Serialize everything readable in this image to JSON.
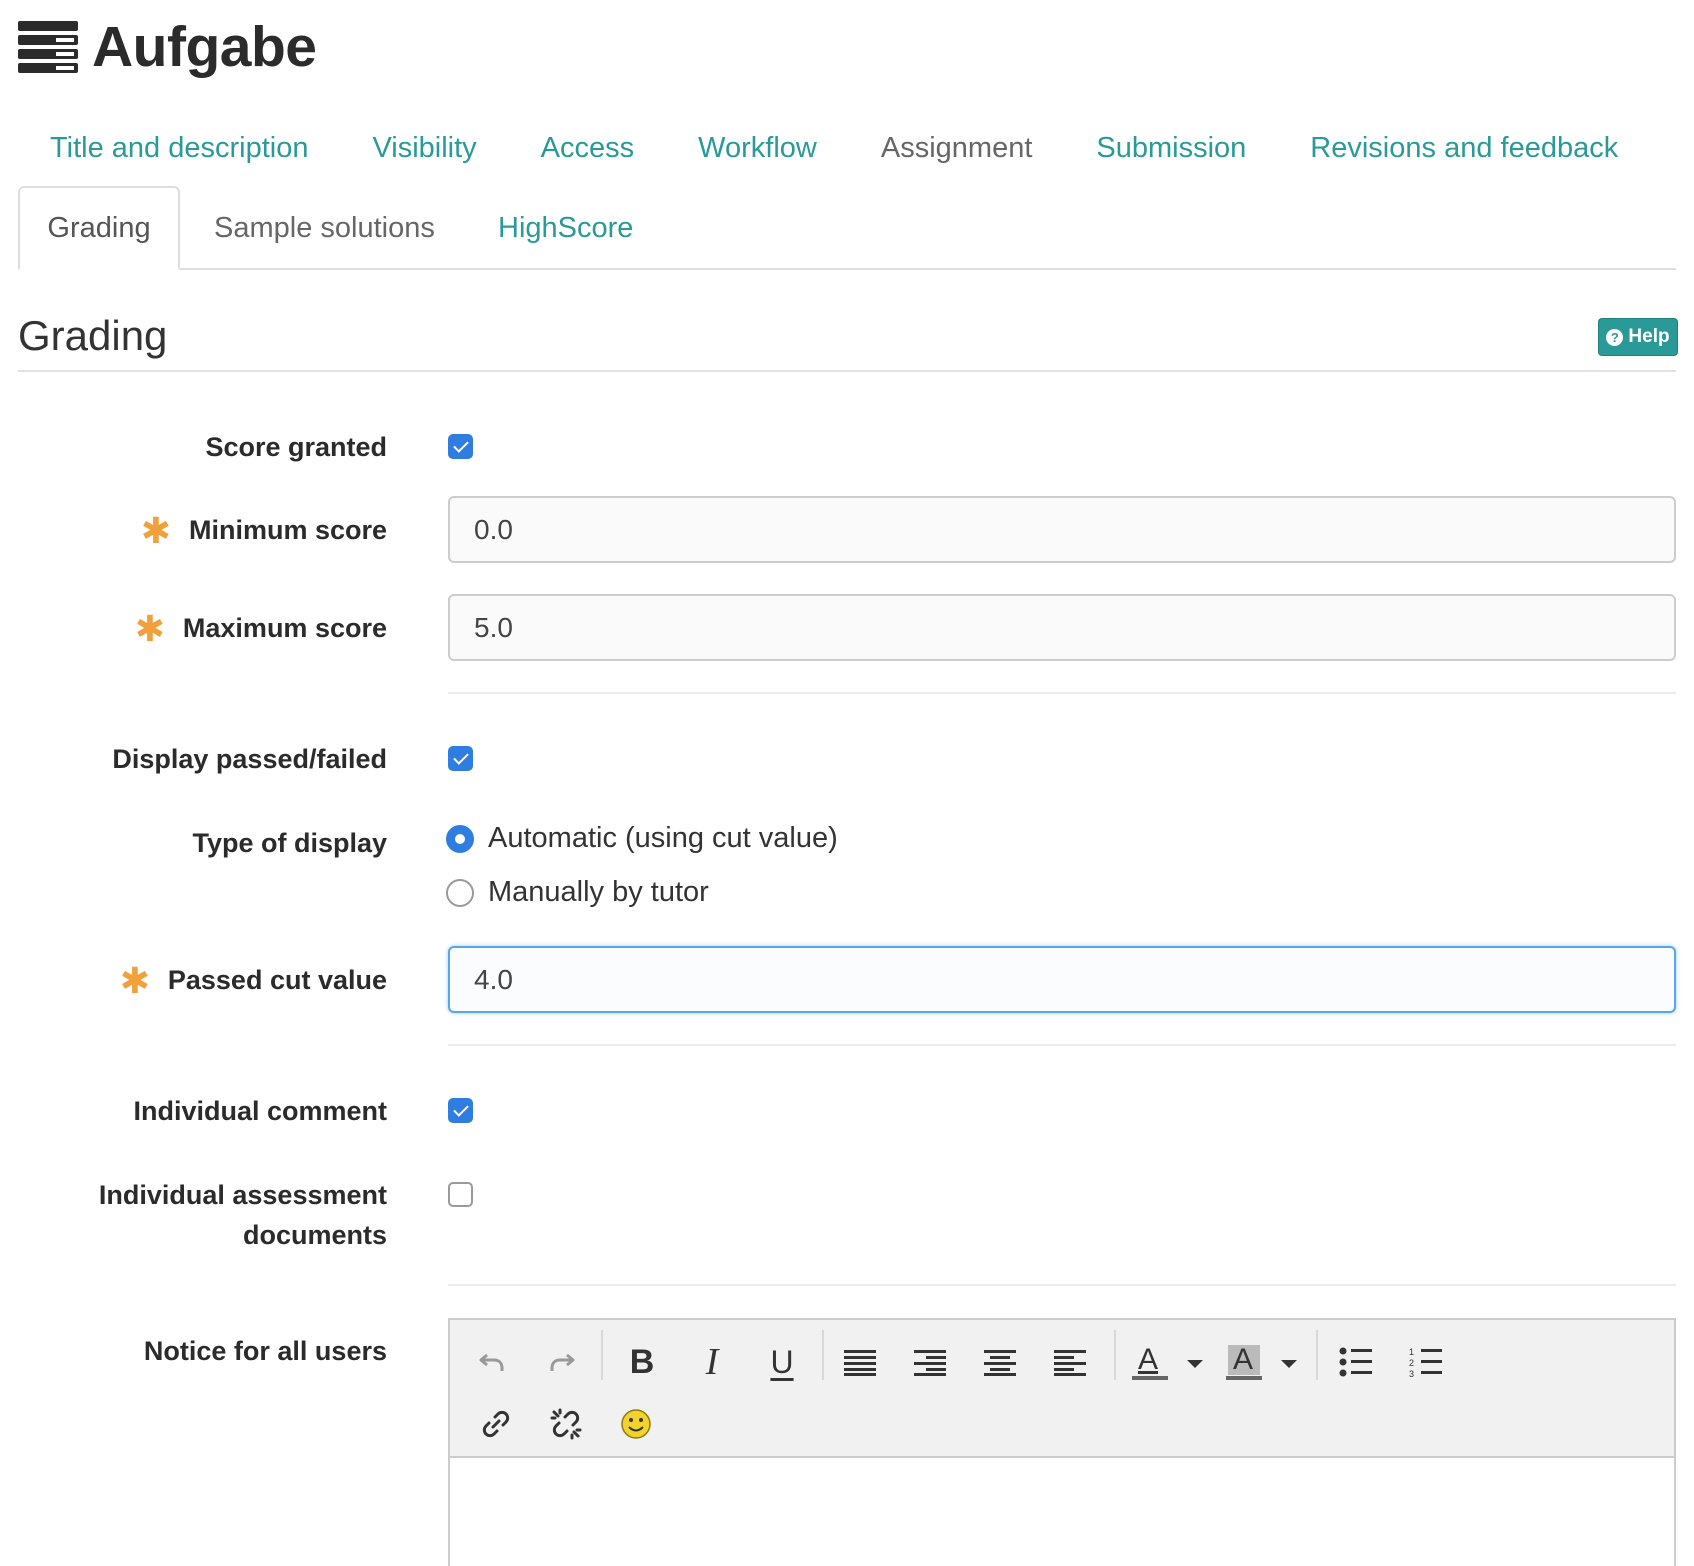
{
  "header": {
    "title": "Aufgabe",
    "icon": "course-node-list-icon"
  },
  "tabs_row1": [
    {
      "label": "Title and description",
      "active": false
    },
    {
      "label": "Visibility",
      "active": false
    },
    {
      "label": "Access",
      "active": false
    },
    {
      "label": "Workflow",
      "active": false
    },
    {
      "label": "Assignment",
      "active": false
    },
    {
      "label": "Submission",
      "active": false
    },
    {
      "label": "Revisions and feedback",
      "active": false
    }
  ],
  "tabs_row2": [
    {
      "label": "Grading",
      "active": true
    },
    {
      "label": "Sample solutions",
      "active": false
    },
    {
      "label": "HighScore",
      "active": false
    }
  ],
  "section": {
    "title": "Grading",
    "help_label": "Help"
  },
  "form": {
    "score_granted": {
      "label": "Score granted",
      "checked": true
    },
    "minimum_score": {
      "label": "Minimum score",
      "value": "0.0",
      "required": true
    },
    "maximum_score": {
      "label": "Maximum score",
      "value": "5.0",
      "required": true
    },
    "display_passed_failed": {
      "label": "Display passed/failed",
      "checked": true
    },
    "type_of_display": {
      "label": "Type of display",
      "options": [
        {
          "label": "Automatic (using cut value)",
          "selected": true
        },
        {
          "label": "Manually by tutor",
          "selected": false
        }
      ]
    },
    "passed_cut_value": {
      "label": "Passed cut value",
      "value": "4.0",
      "required": true
    },
    "individual_comment": {
      "label": "Individual comment",
      "checked": true
    },
    "individual_assessment_documents": {
      "label_line1": "Individual assessment",
      "label_line2": "documents",
      "checked": false
    },
    "notice_for_all_users": {
      "label": "Notice for all users"
    }
  },
  "editor_toolbar": {
    "buttons": [
      "undo-icon",
      "redo-icon",
      "bold-icon",
      "italic-icon",
      "underline-icon",
      "align-justify-icon",
      "align-right-icon",
      "align-center-icon",
      "align-left-icon",
      "text-color-icon",
      "background-color-icon",
      "bullet-list-icon",
      "numbered-list-icon",
      "link-icon",
      "unlink-icon",
      "emoticon-icon"
    ],
    "bold_glyph": "B",
    "italic_glyph": "I",
    "underline_glyph": "U",
    "text_color_glyph": "A",
    "bg_color_glyph": "A"
  },
  "colors": {
    "accent": "#2a9a98",
    "checkbox_blue": "#2f7de0",
    "required_star": "#f0a13c"
  }
}
